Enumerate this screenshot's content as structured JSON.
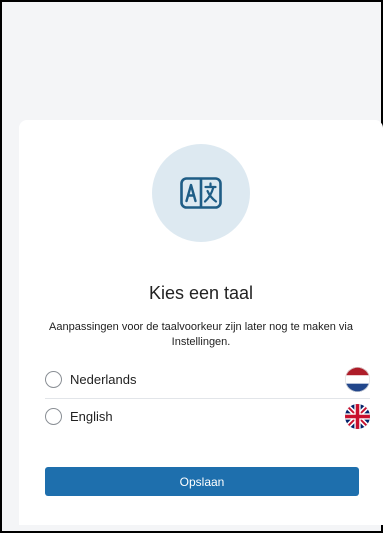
{
  "language_modal": {
    "title": "Kies een taal",
    "description": "Aanpassingen voor de taalvoorkeur zijn later nog te maken via Instellingen.",
    "options": [
      {
        "label": "Nederlands",
        "flag": "netherlands-flag-icon",
        "selected": false
      },
      {
        "label": "English",
        "flag": "uk-flag-icon",
        "selected": false
      }
    ],
    "save_label": "Opslaan",
    "icon": "translate-icon"
  },
  "colors": {
    "accent": "#1e6fad",
    "icon_circle": "#dde9f1",
    "icon_stroke": "#1f5d86",
    "text": "#222222",
    "backdrop": "#f4f5f7"
  }
}
